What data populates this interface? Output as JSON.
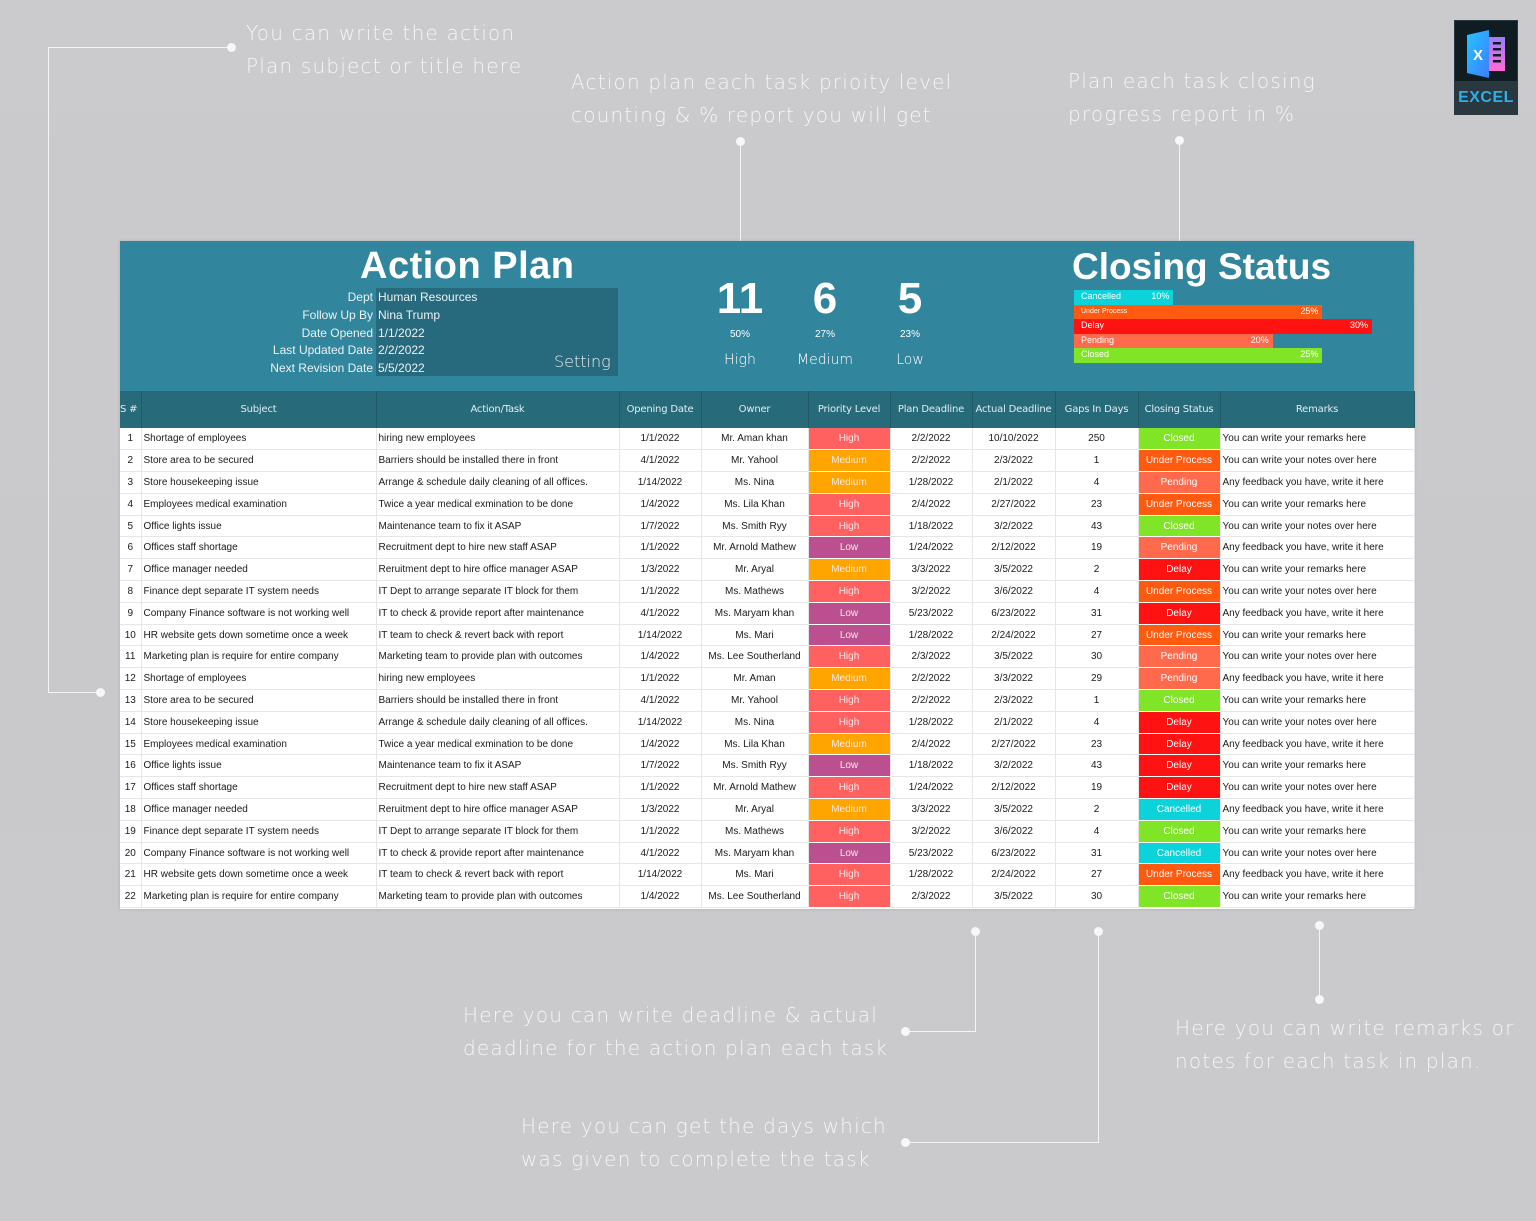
{
  "callouts": {
    "title_hint": [
      "You can write the action",
      "Plan subject or title here"
    ],
    "priority_hint": [
      "Action plan each task prioity level",
      "counting & % report you will get"
    ],
    "closing_hint": [
      "Plan each task closing",
      "progress report in %"
    ],
    "deadline_hint": [
      "Here you can write deadline & actual",
      "deadline for the action plan each task"
    ],
    "days_hint": [
      "Here you can get the days which",
      "was given to complete the task"
    ],
    "remarks_hint": [
      "Here you can write remarks or",
      "notes for each task in plan."
    ]
  },
  "badge": {
    "label": "EXCEL",
    "icon": "excel-logo-icon"
  },
  "header": {
    "title": "Action Plan",
    "info": [
      {
        "label": "Dept",
        "value": "Human Resources"
      },
      {
        "label": "Follow Up By",
        "value": "Nina Trump"
      },
      {
        "label": "Date Opened",
        "value": "1/1/2022"
      },
      {
        "label": "Last Updated Date",
        "value": "2/2/2022"
      },
      {
        "label": "Next Revision Date",
        "value": "5/5/2022"
      }
    ],
    "setting_label": "Setting"
  },
  "priority_summary": [
    {
      "count": "11",
      "percent": "50%",
      "label": "High"
    },
    {
      "count": "6",
      "percent": "27%",
      "label": "Medium"
    },
    {
      "count": "5",
      "percent": "23%",
      "label": "Low"
    }
  ],
  "closing_status": {
    "title": "Closing Status",
    "bars": [
      {
        "label": "Cancelled",
        "percent": 10,
        "display": "10%",
        "color": "#0bd3d9"
      },
      {
        "label": "Under Process",
        "percent": 25,
        "display": "25%",
        "color": "#ff5a0f"
      },
      {
        "label": "Delay",
        "percent": 30,
        "display": "30%",
        "color": "#ff1212"
      },
      {
        "label": "Pending",
        "percent": 20,
        "display": "20%",
        "color": "#ff6a4d"
      },
      {
        "label": "Closed",
        "percent": 25,
        "display": "25%",
        "color": "#80e527"
      }
    ]
  },
  "colors": {
    "banner": "#31859c",
    "header_row": "#276b7a",
    "priority": {
      "High": "#ff6060",
      "Medium": "#ffa500",
      "Low": "#bb4f8f"
    },
    "status": {
      "Closed": "#80e527",
      "Under Process": "#ff5a0f",
      "Pending": "#ff6a4d",
      "Delay": "#ff1212",
      "Cancelled": "#0bd3d9"
    }
  },
  "table": {
    "columns": [
      "S #",
      "Subject",
      "Action/Task",
      "Opening Date",
      "Owner",
      "Priority Level",
      "Plan Deadline",
      "Actual Deadline",
      "Gaps In Days",
      "Closing Status",
      "Remarks"
    ],
    "rows": [
      [
        "1",
        "Shortage of employees",
        "hiring new employees",
        "1/1/2022",
        "Mr. Aman khan",
        "High",
        "2/2/2022",
        "10/10/2022",
        "250",
        "Closed",
        "You can write your remarks here"
      ],
      [
        "2",
        "Store area to be secured",
        "Barriers should be installed there in front",
        "4/1/2022",
        "Mr. Yahool",
        "Medium",
        "2/2/2022",
        "2/3/2022",
        "1",
        "Under Process",
        "You can write your notes over here"
      ],
      [
        "3",
        "Store housekeeping issue",
        "Arrange & schedule daily cleaning of all offices.",
        "1/14/2022",
        "Ms. Nina",
        "Medium",
        "1/28/2022",
        "2/1/2022",
        "4",
        "Pending",
        "Any feedback you have, write it here"
      ],
      [
        "4",
        "Employees medical examination",
        "Twice a year medical exmination to be done",
        "1/4/2022",
        "Ms. Lila Khan",
        "High",
        "2/4/2022",
        "2/27/2022",
        "23",
        "Under Process",
        "You can write your remarks here"
      ],
      [
        "5",
        "Office lights issue",
        "Maintenance team to fix it ASAP",
        "1/7/2022",
        "Ms. Smith Ryy",
        "High",
        "1/18/2022",
        "3/2/2022",
        "43",
        "Closed",
        "You can write your notes over here"
      ],
      [
        "6",
        "Offices staff shortage",
        "Recruitment dept to hire new staff ASAP",
        "1/1/2022",
        "Mr. Arnold Mathew",
        "Low",
        "1/24/2022",
        "2/12/2022",
        "19",
        "Pending",
        "Any feedback you have, write it here"
      ],
      [
        "7",
        "Office manager needed",
        "Reruitment dept to hire office manager ASAP",
        "1/3/2022",
        "Mr. Aryal",
        "Medium",
        "3/3/2022",
        "3/5/2022",
        "2",
        "Delay",
        "You can write your remarks here"
      ],
      [
        "8",
        "Finance dept separate IT system needs",
        "IT Dept to arrange separate IT block for them",
        "1/1/2022",
        "Ms. Mathews",
        "High",
        "3/2/2022",
        "3/6/2022",
        "4",
        "Under Process",
        "You can write your notes over here"
      ],
      [
        "9",
        "Company Finance software is not working well",
        "IT to check & provide report after maintenance",
        "4/1/2022",
        "Ms. Maryam khan",
        "Low",
        "5/23/2022",
        "6/23/2022",
        "31",
        "Delay",
        "Any feedback you have, write it here"
      ],
      [
        "10",
        "HR website gets down sometime once a week",
        "IT team to check & revert back with report",
        "1/14/2022",
        "Ms. Mari",
        "Low",
        "1/28/2022",
        "2/24/2022",
        "27",
        "Under Process",
        "You can write your remarks here"
      ],
      [
        "11",
        "Marketing plan is require for entire company",
        "Marketing team to provide plan with outcomes",
        "1/4/2022",
        "Ms. Lee Southerland",
        "High",
        "2/3/2022",
        "3/5/2022",
        "30",
        "Pending",
        "You can write your notes over here"
      ],
      [
        "12",
        "Shortage of employees",
        "hiring new employees",
        "1/1/2022",
        "Mr. Aman",
        "Medium",
        "2/2/2022",
        "3/3/2022",
        "29",
        "Pending",
        "Any feedback you have, write it here"
      ],
      [
        "13",
        "Store area to be secured",
        "Barriers should be installed there in front",
        "4/1/2022",
        "Mr. Yahool",
        "High",
        "2/2/2022",
        "2/3/2022",
        "1",
        "Closed",
        "You can write your remarks here"
      ],
      [
        "14",
        "Store housekeeping issue",
        "Arrange & schedule daily cleaning of all offices.",
        "1/14/2022",
        "Ms. Nina",
        "High",
        "1/28/2022",
        "2/1/2022",
        "4",
        "Delay",
        "You can write your notes over here"
      ],
      [
        "15",
        "Employees medical examination",
        "Twice a year medical exmination to be done",
        "1/4/2022",
        "Ms. Lila Khan",
        "Medium",
        "2/4/2022",
        "2/27/2022",
        "23",
        "Delay",
        "Any feedback you have, write it here"
      ],
      [
        "16",
        "Office lights issue",
        "Maintenance team to fix it ASAP",
        "1/7/2022",
        "Ms. Smith Ryy",
        "Low",
        "1/18/2022",
        "3/2/2022",
        "43",
        "Delay",
        "You can write your remarks here"
      ],
      [
        "17",
        "Offices staff shortage",
        "Recruitment dept to hire new staff ASAP",
        "1/1/2022",
        "Mr. Arnold Mathew",
        "High",
        "1/24/2022",
        "2/12/2022",
        "19",
        "Delay",
        "You can write your notes over here"
      ],
      [
        "18",
        "Office manager needed",
        "Reruitment dept to hire office manager ASAP",
        "1/3/2022",
        "Mr. Aryal",
        "Medium",
        "3/3/2022",
        "3/5/2022",
        "2",
        "Cancelled",
        "Any feedback you have, write it here"
      ],
      [
        "19",
        "Finance dept separate IT system needs",
        "IT Dept to arrange separate IT block for them",
        "1/1/2022",
        "Ms. Mathews",
        "High",
        "3/2/2022",
        "3/6/2022",
        "4",
        "Closed",
        "You can write your remarks here"
      ],
      [
        "20",
        "Company Finance software is not working well",
        "IT to check & provide report after maintenance",
        "4/1/2022",
        "Ms. Maryam khan",
        "Low",
        "5/23/2022",
        "6/23/2022",
        "31",
        "Cancelled",
        "You can write your notes over here"
      ],
      [
        "21",
        "HR website gets down sometime once a week",
        "IT team to check & revert back with report",
        "1/14/2022",
        "Ms. Mari",
        "High",
        "1/28/2022",
        "2/24/2022",
        "27",
        "Under Process",
        "Any feedback you have, write it here"
      ],
      [
        "22",
        "Marketing plan is require for entire company",
        "Marketing team to provide plan with outcomes",
        "1/4/2022",
        "Ms. Lee Southerland",
        "High",
        "2/3/2022",
        "3/5/2022",
        "30",
        "Closed",
        "You can write your remarks here"
      ]
    ]
  }
}
